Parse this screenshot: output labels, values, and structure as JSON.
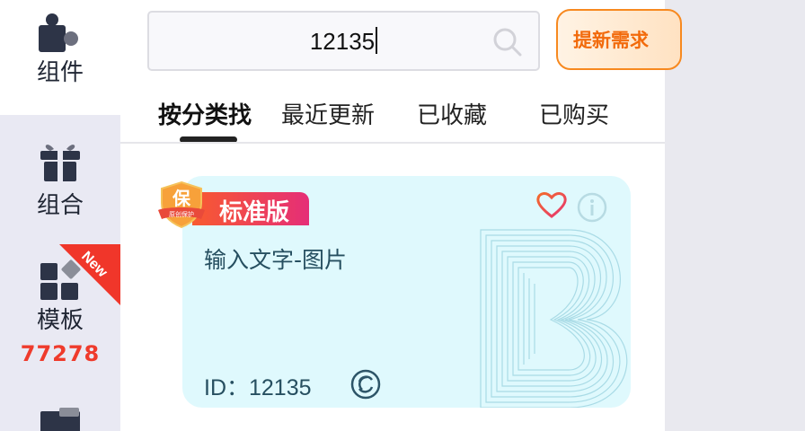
{
  "sidebar": {
    "items": [
      {
        "label": "组件",
        "icon": "puzzle-icon",
        "active": true
      },
      {
        "label": "组合",
        "icon": "gift-icon"
      },
      {
        "label": "模板",
        "icon": "template-grid-icon",
        "badge": "New",
        "count": "77278"
      },
      {
        "icon": "folder-icon"
      }
    ]
  },
  "search": {
    "value": "12135",
    "icon": "search-icon"
  },
  "request_button": {
    "label": "提新需求"
  },
  "tabs": [
    {
      "label": "按分类找",
      "active": true
    },
    {
      "label": "最近更新"
    },
    {
      "label": "已收藏"
    },
    {
      "label": "已购买"
    }
  ],
  "card": {
    "badge": "标准版",
    "shield_text": "保",
    "shield_subtext": "原创保护",
    "title": "输入文字-图片",
    "id_text": "ID：12135",
    "icons": [
      "heart-icon",
      "info-icon",
      "share-icon"
    ]
  },
  "colors": {
    "accent_orange": "#f26a0b",
    "badge_red": "#e52e77",
    "count_red": "#ef3b2c",
    "card_bg": "#dff9fd"
  }
}
